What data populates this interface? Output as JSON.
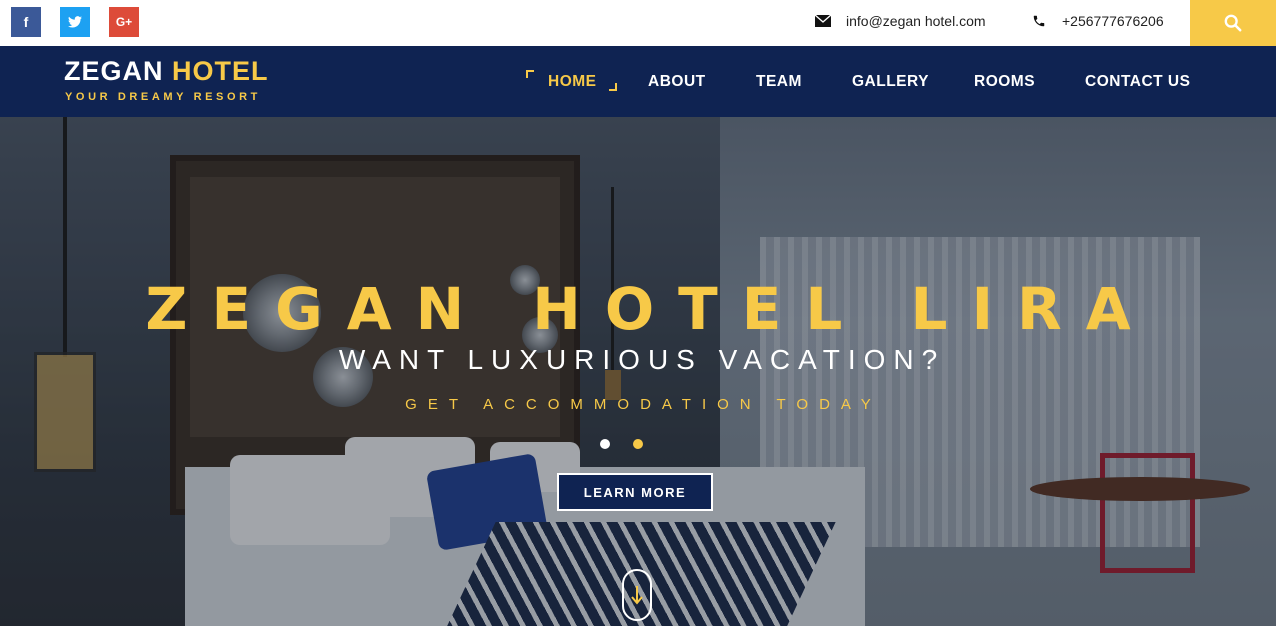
{
  "topbar": {
    "social": [
      {
        "icon": "facebook-icon",
        "glyph": "f"
      },
      {
        "icon": "twitter-icon",
        "glyph": "t"
      },
      {
        "icon": "google-plus-icon",
        "glyph": "G+"
      }
    ],
    "email": "info@zegan hotel.com",
    "phone": "+256777676206",
    "search_icon": "search-icon"
  },
  "header": {
    "logo_main": "ZEGAN",
    "logo_accent": "HOTEL",
    "logo_sub": "YOUR DREAMY RESORT"
  },
  "nav": {
    "items": [
      {
        "label": "HOME",
        "active": true
      },
      {
        "label": "ABOUT",
        "active": false
      },
      {
        "label": "TEAM",
        "active": false
      },
      {
        "label": "GALLERY",
        "active": false
      },
      {
        "label": "ROOMS",
        "active": false
      },
      {
        "label": "CONTACT US",
        "active": false
      }
    ]
  },
  "hero": {
    "title": "ZEGAN HOTEL LIRA",
    "subtitle": "WANT LUXURIOUS VACATION?",
    "tagline": "GET ACCOMMODATION TODAY",
    "button_label": "LEARN MORE",
    "slide_count": 2,
    "active_slide": 2
  },
  "colors": {
    "accent": "#f7c948",
    "navy": "#0f2352"
  }
}
